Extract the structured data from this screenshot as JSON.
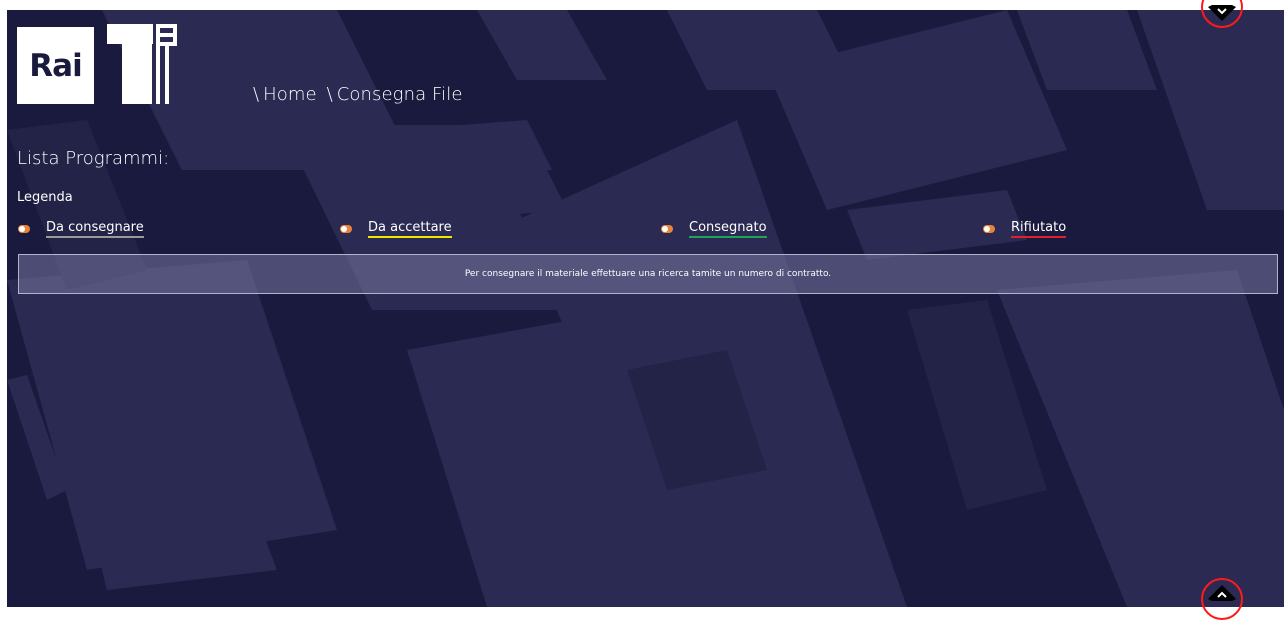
{
  "header": {
    "rai_logo_text": "Rai",
    "breadcrumb": [
      "Home",
      "Consegna File"
    ],
    "separator": "\\"
  },
  "main": {
    "title": "Lista Programmi:",
    "legend": {
      "title": "Legenda",
      "items": [
        {
          "label": "Da consegnare",
          "color": "#9a9a9a"
        },
        {
          "label": "Da accettare",
          "color": "#f2e600"
        },
        {
          "label": "Consegnato",
          "color": "#1fa35a"
        },
        {
          "label": "Rifiutato",
          "color": "#e0202a"
        }
      ]
    },
    "info_message": "Per consegnare il materiale effettuare una ricerca tamite un numero di contratto."
  },
  "controls": {
    "scroll_down_icon": "chevron-down-icon",
    "scroll_up_icon": "chevron-up-icon"
  },
  "colors": {
    "background": "#1a1a3f",
    "toggle_accent": "#e8843a",
    "highlight_circle": "#ff1a1a"
  }
}
